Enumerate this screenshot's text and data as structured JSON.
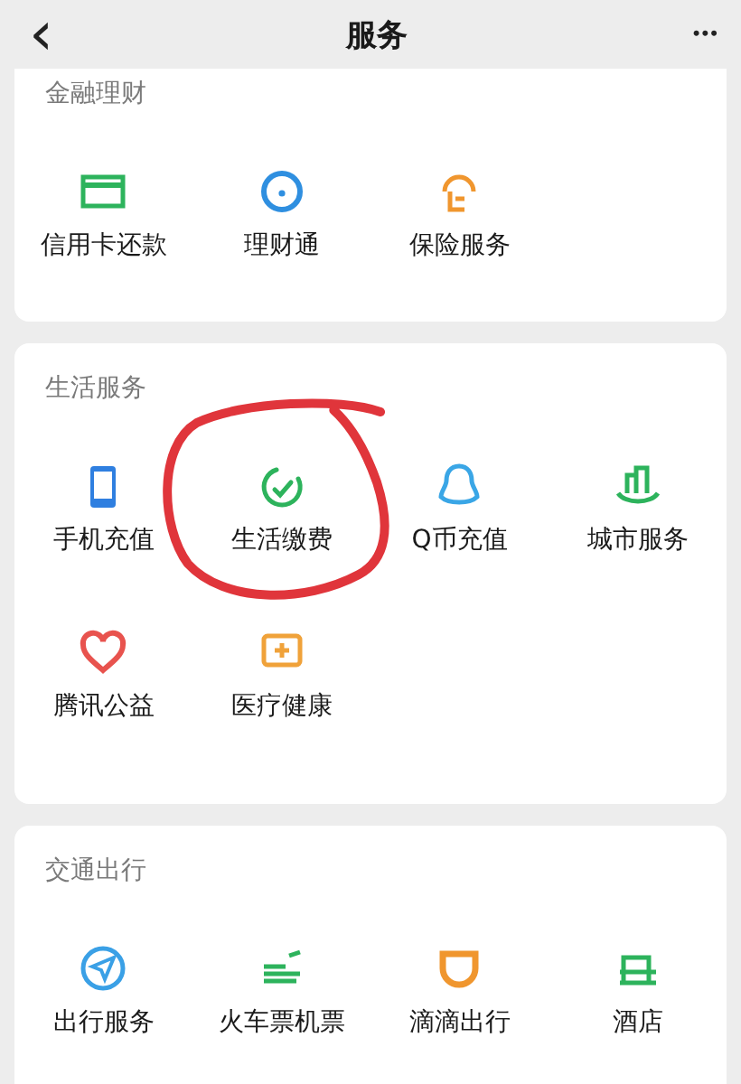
{
  "header": {
    "back": "‹",
    "title": "服务",
    "more": "•••"
  },
  "sections": [
    {
      "title": "金融理财",
      "items": [
        {
          "label": "信用卡还款",
          "color": "#2db35c",
          "circled": false
        },
        {
          "label": "理财通",
          "color": "#2f8fe0",
          "circled": false
        },
        {
          "label": "保险服务",
          "color": "#f0962e",
          "circled": false
        }
      ]
    },
    {
      "title": "生活服务",
      "items": [
        {
          "label": "手机充值",
          "color": "#2f7fe0",
          "circled": false
        },
        {
          "label": "生活缴费",
          "color": "#2db35c",
          "circled": true
        },
        {
          "label": "Q币充值",
          "color": "#3aa6e6",
          "circled": false
        },
        {
          "label": "城市服务",
          "color": "#2db35c",
          "circled": false
        },
        {
          "label": "腾讯公益",
          "color": "#e8534e",
          "circled": false
        },
        {
          "label": "医疗健康",
          "color": "#f0a23a",
          "circled": false
        }
      ]
    },
    {
      "title": "交通出行",
      "items": [
        {
          "label": "出行服务",
          "color": "#3aa0e6",
          "circled": false
        },
        {
          "label": "火车票机票",
          "color": "#2db35c",
          "circled": false
        },
        {
          "label": "滴滴出行",
          "color": "#f0962e",
          "circled": false
        },
        {
          "label": "酒店",
          "color": "#2db35c",
          "circled": false
        }
      ]
    }
  ]
}
